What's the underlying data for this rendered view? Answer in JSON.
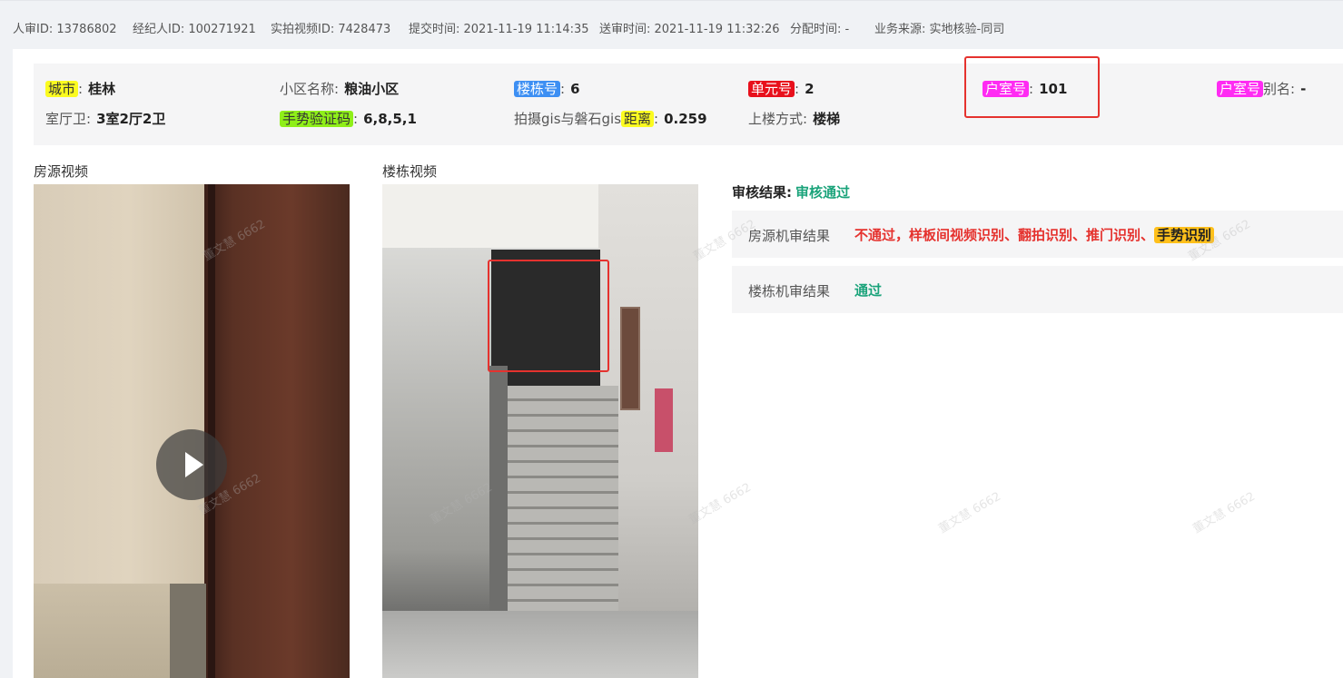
{
  "header": {
    "reviewer_id": "人审ID: 13786802",
    "agent_id": "经纪人ID: 100271921",
    "video_id": "实拍视频ID: 7428473",
    "submit_time": "提交时间: 2021-11-19 11:14:35",
    "send_time": "送审时间: 2021-11-19 11:32:26",
    "assign_time": "分配时间: -",
    "source": "业务来源: 实地核验-同司"
  },
  "info": {
    "city_label": "城市",
    "city_value": "桂林",
    "community_label": "小区名称:",
    "community_value": "粮油小区",
    "building_label": "楼栋号",
    "building_value": "6",
    "unit_label": "单元号",
    "unit_value": "2",
    "room_label": "户室号",
    "room_value": "101",
    "room_alias_tag": "户室号",
    "room_alias_suffix": "别名:",
    "room_alias_value": "-",
    "layout_label": "室厅卫:",
    "layout_value": "3室2厅2卫",
    "gesture_label": "手势验证码",
    "gesture_value": "6,8,5,1",
    "distance_prefix": "拍摄gis与磐石gis",
    "distance_tag": "距离",
    "distance_value": "0.259",
    "stairs_label": "上楼方式:",
    "stairs_value": "楼梯",
    "colon": ":"
  },
  "videos": {
    "house_label": "房源视频",
    "building_label": "楼栋视频"
  },
  "review": {
    "title": "审核结果:",
    "status": "审核通过",
    "house_label": "房源机审结果",
    "house_result": "不通过，样板间视频识别、翻拍识别、推门识别、",
    "house_result_tag": "手势识别",
    "building_label": "楼栋机审结果",
    "building_result": "通过"
  },
  "watermark": "董文慧 6662",
  "colors": {
    "highlight_yellow": "#fbfb20",
    "highlight_blue": "#3d8ff3",
    "highlight_red": "#e8101c",
    "highlight_magenta": "#ff2bf3",
    "highlight_green": "#8fef19",
    "highlight_orange": "#ffc01b",
    "pass_green": "#1aa37a",
    "fail_red": "#e5322e",
    "annotation_red": "#e5322e"
  }
}
